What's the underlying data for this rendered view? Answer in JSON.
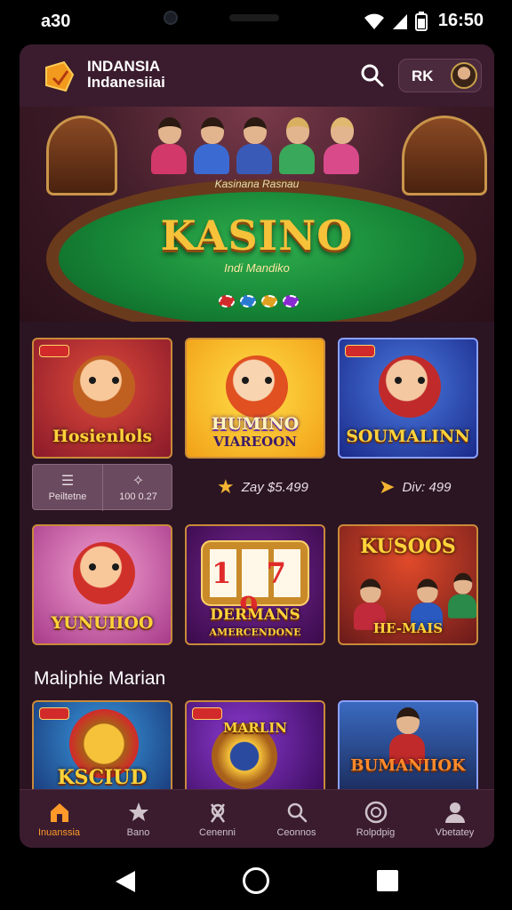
{
  "status_bar": {
    "time_left": "a30",
    "time_right": "16:50"
  },
  "header": {
    "brand_line1": "INDANSIA",
    "brand_line2": "Indanesiiai",
    "user_label": "RK"
  },
  "hero": {
    "subtitle": "Kasinana Rasnau",
    "title": "KASINO",
    "tagline": "Indi Mandiko"
  },
  "games_row1": [
    {
      "title": "Hosienlols"
    },
    {
      "title": "HUMINO",
      "subtitle": "VIAREOON"
    },
    {
      "title": "SOUMALINN"
    }
  ],
  "info": {
    "left_label": "Peiltetne",
    "right_value": "100 0.27",
    "stat1": "Zay $5.499",
    "stat2": "Div: 499"
  },
  "games_row2": [
    {
      "title": "YUNUIIOO"
    },
    {
      "title": "DERMANS",
      "subtitle": "AMERCENDONE",
      "slot_numbers": "1 7 9"
    },
    {
      "title": "KUSOOS",
      "subtitle": "HE-MAIS"
    }
  ],
  "section_heading": "Maliphie Marian",
  "games_row3": [
    {
      "title": "KSCIUD"
    },
    {
      "title": "MARLIN"
    },
    {
      "title": "BUMANIIOK"
    }
  ],
  "bottom_nav": [
    {
      "label": "Inuanssia",
      "icon": "home-icon",
      "active": true
    },
    {
      "label": "Bano",
      "icon": "star-icon",
      "active": false
    },
    {
      "label": "Cenenni",
      "icon": "dice-icon",
      "active": false
    },
    {
      "label": "Ceonnos",
      "icon": "search-icon",
      "active": false
    },
    {
      "label": "Rolpdpig",
      "icon": "slot-icon",
      "active": false
    },
    {
      "label": "Vbetatey",
      "icon": "user-icon",
      "active": false
    }
  ],
  "colors": {
    "accent": "#ff9a2a",
    "app_bg": "#2b1523",
    "gold": "#f6c23a"
  }
}
